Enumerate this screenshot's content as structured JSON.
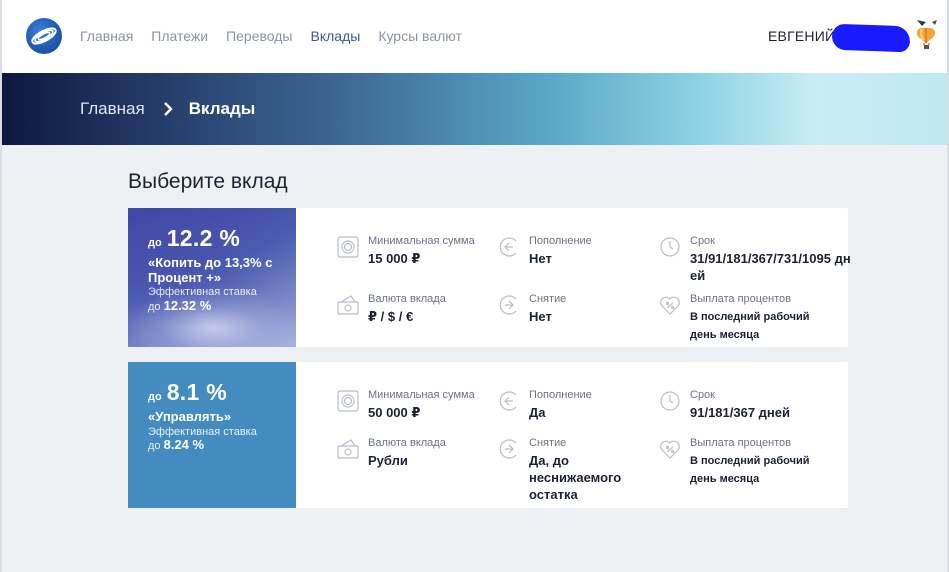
{
  "header": {
    "nav": [
      {
        "label": "Главная",
        "active": false
      },
      {
        "label": "Платежи",
        "active": false
      },
      {
        "label": "Переводы",
        "active": false
      },
      {
        "label": "Вклады",
        "active": true
      },
      {
        "label": "Курсы валют",
        "active": false
      }
    ],
    "user_name": "ЕВГЕНИЙ"
  },
  "breadcrumb": {
    "home": "Главная",
    "current": "Вклады"
  },
  "page_title": "Выберите вклад",
  "deposits": [
    {
      "rate_prefix": "до",
      "rate": "12.2 %",
      "name": "«Копить до 13,3% с Процент +»",
      "effective_label": "Эффективная ставка",
      "effective_prefix": "до",
      "effective_rate": "12.32 %",
      "features": {
        "min_sum": {
          "label": "Минимальная сумма",
          "value": "15 000 ₽"
        },
        "replenish": {
          "label": "Пополнение",
          "value": "Нет"
        },
        "term": {
          "label": "Срок",
          "value": "31/91/181/367/731/1095 дней"
        },
        "currency": {
          "label": "Валюта вклада",
          "value": "₽ / $ / €"
        },
        "withdraw": {
          "label": "Снятие",
          "value": "Нет"
        },
        "payout": {
          "label": "Выплата процентов",
          "value": "В последний рабочий день месяца"
        }
      }
    },
    {
      "rate_prefix": "до",
      "rate": "8.1 %",
      "name": "«Управлять»",
      "effective_label": "Эффективная ставка",
      "effective_prefix": "до",
      "effective_rate": "8.24 %",
      "features": {
        "min_sum": {
          "label": "Минимальная сумма",
          "value": "50 000 ₽"
        },
        "replenish": {
          "label": "Пополнение",
          "value": "Да"
        },
        "term": {
          "label": "Срок",
          "value": "91/181/367 дней"
        },
        "currency": {
          "label": "Валюта вклада",
          "value": "Рубли"
        },
        "withdraw": {
          "label": "Снятие",
          "value": "Да, до неснижаемого остатка"
        },
        "payout": {
          "label": "Выплата процентов",
          "value": "В последний рабочий день месяца"
        }
      }
    }
  ],
  "colors": {
    "card2_panel": "#448bc0",
    "nav_active": "#3c5a8f",
    "nav_inactive": "#8b93a3"
  }
}
